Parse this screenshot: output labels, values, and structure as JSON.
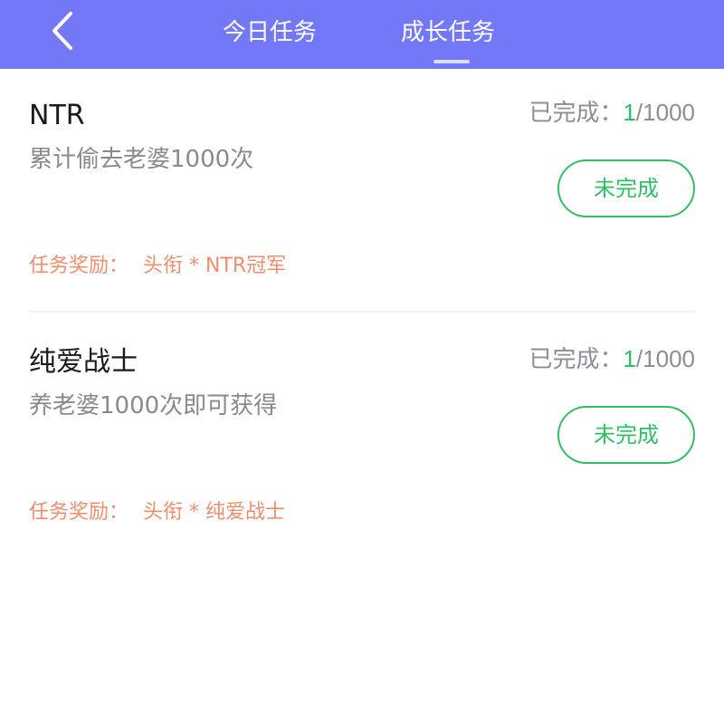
{
  "colors": {
    "header_bg": "#7378f7",
    "accent_green": "#2fbf66",
    "reward_orange": "#ee8f6c"
  },
  "header": {
    "back_icon": "chevron-left-icon",
    "tabs": [
      {
        "label": "今日任务",
        "active": false
      },
      {
        "label": "成长任务",
        "active": true
      }
    ]
  },
  "tasks": [
    {
      "title": "NTR",
      "description": "累计偷去老婆1000次",
      "progress_label": "已完成：",
      "progress_done": "1",
      "progress_total": "/1000",
      "status_label": "未完成",
      "reward_label": "任务奖励：",
      "reward_value": "头衔 * NTR冠军"
    },
    {
      "title": "纯爱战士",
      "description": "养老婆1000次即可获得",
      "progress_label": "已完成：",
      "progress_done": "1",
      "progress_total": "/1000",
      "status_label": "未完成",
      "reward_label": "任务奖励：",
      "reward_value": "头衔 * 纯爱战士"
    }
  ]
}
